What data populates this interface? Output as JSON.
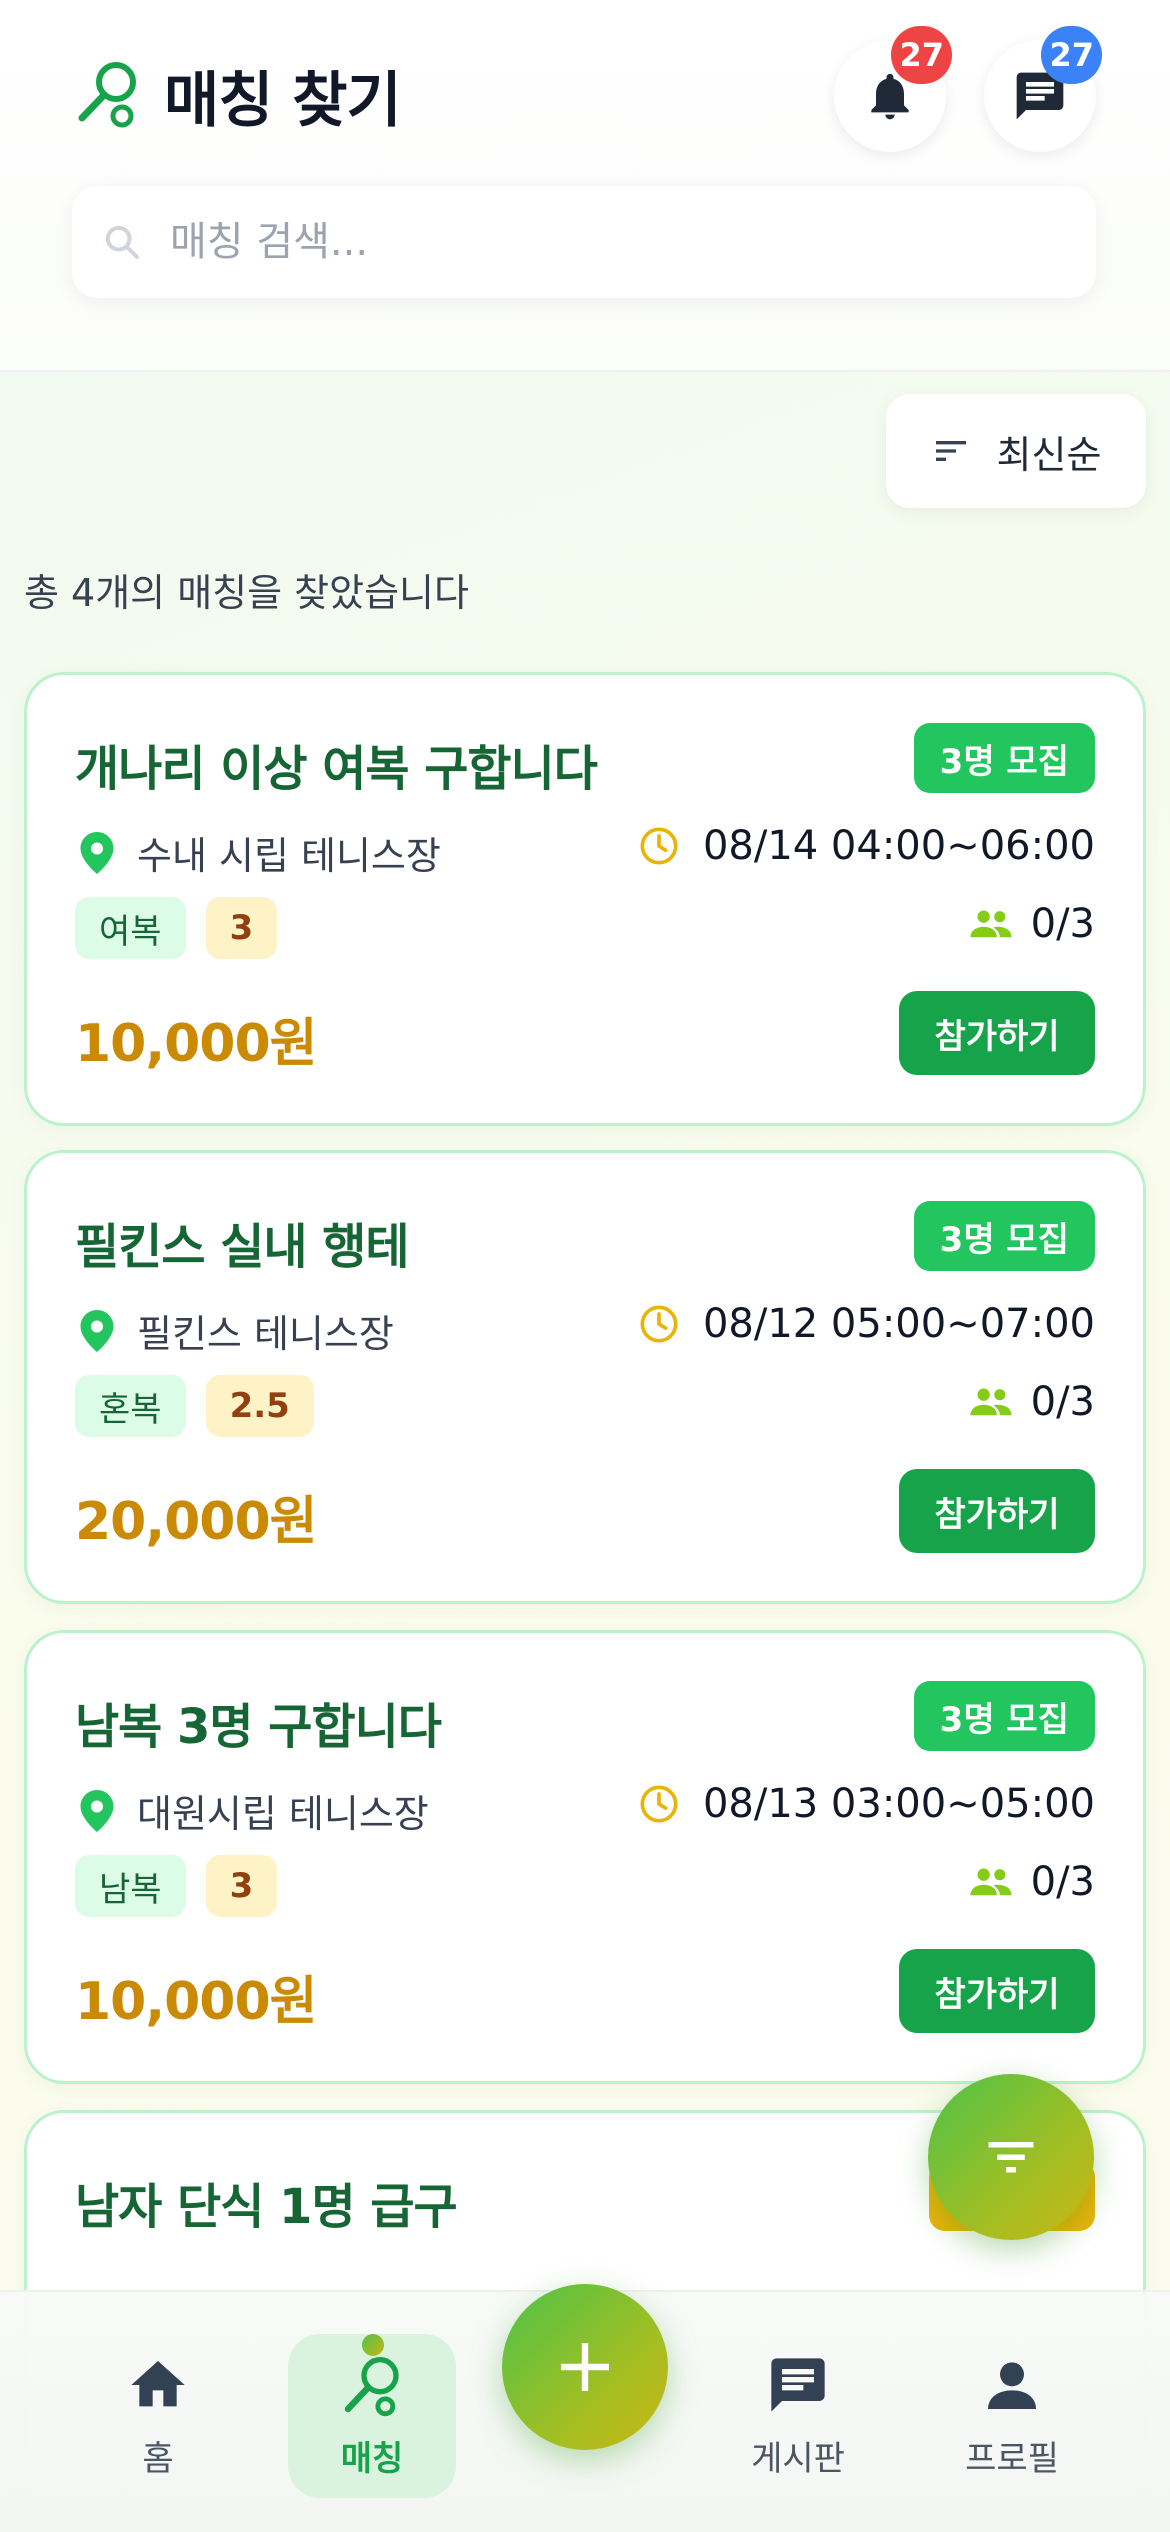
{
  "header": {
    "title": "매칭 찾기",
    "logo_icon": "racket-icon",
    "notifications_count": "27",
    "messages_count": "27"
  },
  "search": {
    "placeholder": "매칭 검색...",
    "value": ""
  },
  "sort": {
    "label": "최신순"
  },
  "result_count_text": "총 4개의 매칭을 찾았습니다",
  "colors": {
    "primary": "#16a34a",
    "accent_yellow": "#ca8a04",
    "badge_red": "#ef4444",
    "badge_blue": "#3b82f6"
  },
  "matches": [
    {
      "title": "개나리 이상 여복 구합니다",
      "recruit": "3명 모집",
      "location": "수내 시립 테니스장",
      "time": "08/14 04:00~06:00",
      "type": "여복",
      "level": "3",
      "participants": "0/3",
      "price": "10,000원",
      "join_label": "참가하기"
    },
    {
      "title": "필킨스 실내 행테",
      "recruit": "3명 모집",
      "location": "필킨스 테니스장",
      "time": "08/12 05:00~07:00",
      "type": "혼복",
      "level": "2.5",
      "participants": "0/3",
      "price": "20,000원",
      "join_label": "참가하기"
    },
    {
      "title": "남복 3명 구합니다",
      "recruit": "3명 모집",
      "location": "대원시립 테니스장",
      "time": "08/13 03:00~05:00",
      "type": "남복",
      "level": "3",
      "participants": "0/3",
      "price": "10,000원",
      "join_label": "참가하기"
    },
    {
      "title": "남자 단식 1명 급구"
    }
  ],
  "bottom_nav": {
    "items": [
      {
        "label": "홈",
        "icon": "home-icon"
      },
      {
        "label": "매칭",
        "icon": "racket-icon"
      },
      {
        "label": "게시판",
        "icon": "board-icon"
      },
      {
        "label": "프로필",
        "icon": "profile-icon"
      }
    ],
    "add_icon": "plus-icon"
  }
}
